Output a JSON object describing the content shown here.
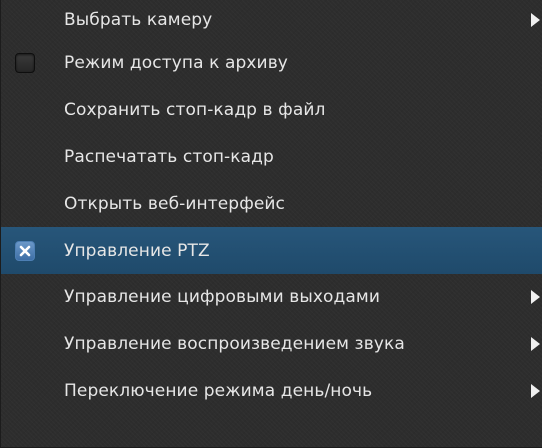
{
  "menu": {
    "items": [
      {
        "label": "Выбрать камеру",
        "has_submenu": true
      },
      {
        "label": "Режим доступа к архиву",
        "checkbox": "unchecked"
      },
      {
        "label": "Сохранить стоп-кадр в файл"
      },
      {
        "label": "Распечатать стоп-кадр"
      },
      {
        "label": "Открыть веб-интерфейс"
      },
      {
        "label": "Управление PTZ",
        "checkbox": "checked",
        "highlighted": true
      },
      {
        "label": "Управление цифровыми выходами",
        "has_submenu": true
      },
      {
        "label": "Управление воспроизведением звука",
        "has_submenu": true
      },
      {
        "label": "Переключение режима день/ночь",
        "has_submenu": true
      }
    ]
  },
  "colors": {
    "background": "#2d2d2d",
    "text": "#e6e6e6",
    "highlight": "#1f4a6b",
    "checkbox_checked": "#4f82b8"
  },
  "icons": {
    "submenu": "submenu-arrow-icon",
    "checkbox_unchecked": "checkbox-icon",
    "checkbox_checked": "checkbox-checked-icon"
  }
}
